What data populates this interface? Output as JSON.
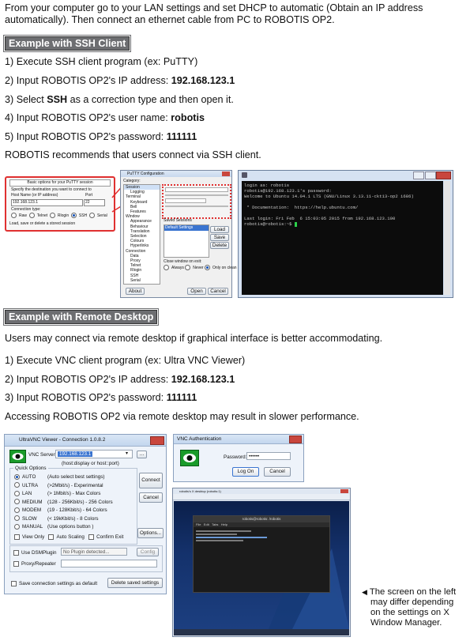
{
  "intro": {
    "line1": "From your computer go to your LAN settings and set DHCP to automatic (Obtain an IP address",
    "line2": "automatically). Then connect an ethernet cable from PC to ROBOTIS OP2."
  },
  "ssh": {
    "header": "Example with SSH Client",
    "steps": [
      {
        "text": "1) Execute SSH client program (ex: PuTTY)",
        "bold": ""
      },
      {
        "text": "2) Input ROBOTIS OP2's IP address: ",
        "bold": "192.168.123.1"
      },
      {
        "pre": "3) Select ",
        "bold": "SSH",
        "post": " as a correction type and then open it."
      },
      {
        "text": "4) Input ROBOTIS OP2's user name: ",
        "bold": "robotis"
      },
      {
        "text": "5) Input ROBOTIS OP2's password: ",
        "bold": "111111"
      }
    ],
    "recommend": "ROBOTIS recommends that users connect via SSH client."
  },
  "putty_zoom": {
    "title": "Basic options for your PuTTY session",
    "dest": "Specify the destination you want to connect to",
    "host_label": "Host Name (or IP address)",
    "port_label": "Port",
    "host_value": "192.168.123.1",
    "port_value": "22",
    "conn_type": "Connection type:",
    "types": [
      "Raw",
      "Telnet",
      "Rlogin",
      "SSH",
      "Serial"
    ],
    "load": "Load, save or delete a stored session"
  },
  "putty_config": {
    "title": "PuTTY Configuration",
    "category": "Category:",
    "tree": [
      "Session",
      "Logging",
      "Terminal",
      "Keyboard",
      "Bell",
      "Features",
      "Window",
      "Appearance",
      "Behaviour",
      "Translation",
      "Selection",
      "Colours",
      "Hyperlinks",
      "Connection",
      "Data",
      "Proxy",
      "Telnet",
      "Rlogin",
      "SSH",
      "Serial"
    ],
    "saved": "Saved Sessions",
    "default": "Default Settings",
    "buttons": [
      "Load",
      "Save",
      "Delete"
    ],
    "close": "Close window on exit:",
    "close_opts": [
      "Always",
      "Never",
      "Only on clean exit"
    ],
    "about": "About",
    "open": "Open",
    "cancel": "Cancel"
  },
  "terminal": {
    "lines": [
      "login as: robotis",
      "robotis@192.168.123.1's password:",
      "Welcome to Ubuntu 14.04.1 LTS (GNU/Linux 3.13.11-ckt13-op2 i686)",
      "",
      " * Documentation:  https://help.ubuntu.com/",
      "",
      "Last login: Fri Feb  6 15:03:05 2015 from 192.168.123.100",
      "robotis@robotis:~$ "
    ]
  },
  "rd": {
    "header": "Example with Remote Desktop",
    "intro": "Users may connect via remote desktop if graphical interface is better accommodating.",
    "steps": [
      {
        "text": "1) Execute VNC client program (ex: Ultra VNC Viewer)",
        "bold": ""
      },
      {
        "text": "2) Input ROBOTIS OP2's IP address: ",
        "bold": "192.168.123.1"
      },
      {
        "text": "3) Input ROBOTIS OP2's password: ",
        "bold": "111111"
      }
    ],
    "note": "Accessing ROBOTIS OP2 via remote desktop may result in slower performance."
  },
  "vnc": {
    "title": "UltraVNC Viewer - Connection 1.0.8.2",
    "server_label": "VNC Server:",
    "server_value": "192.168.123.1",
    "hint": "(host:display or host::port)",
    "quick": "Quick Options",
    "options": [
      {
        "k": "AUTO",
        "v": "(Auto select best settings)"
      },
      {
        "k": "ULTRA",
        "v": "(>2Mbit/s) - Experimental"
      },
      {
        "k": "LAN",
        "v": "(> 1Mbit/s) - Max Colors"
      },
      {
        "k": "MEDIUM",
        "v": "(128 - 256Kbit/s) - 256 Colors"
      },
      {
        "k": "MODEM",
        "v": "(19 - 128Kbit/s) - 64 Colors"
      },
      {
        "k": "SLOW",
        "v": "(< 19kKbit/s) - 8 Colors"
      },
      {
        "k": "MANUAL",
        "v": "(Use options button )"
      }
    ],
    "view_only": "View Only",
    "auto_scaling": "Auto Scaling",
    "confirm_exit": "Confirm Exit",
    "connect": "Connect",
    "cancel": "Cancel",
    "options_btn": "Options...",
    "dsm": "Use DSMPlugin",
    "plugin": "No Plugin detected...",
    "config": "Config",
    "proxy": "Proxy/Repeater",
    "save": "Save connection settings as default",
    "delete": "Delete saved settings"
  },
  "vnc_auth": {
    "title": "VNC Authentication",
    "pw_label": "Password:",
    "pw_value": "••••••",
    "login": "Log On",
    "cancel": "Cancel"
  },
  "desktop": {
    "title": "robotis's X desktop (robotis:1)",
    "term_title": "robotis@robotis: /robotis",
    "menu": [
      "File",
      "Edit",
      "Tabs",
      "Help"
    ]
  },
  "caption": {
    "arrow": "◀",
    "lines": [
      "The screen on the left",
      "may differ depending",
      "on the settings on X",
      "Window Manager."
    ]
  },
  "colors": {
    "header_bg": "#6d6e71",
    "vnc_green": "#1a9b2a",
    "highlight_red": "#e03030"
  }
}
